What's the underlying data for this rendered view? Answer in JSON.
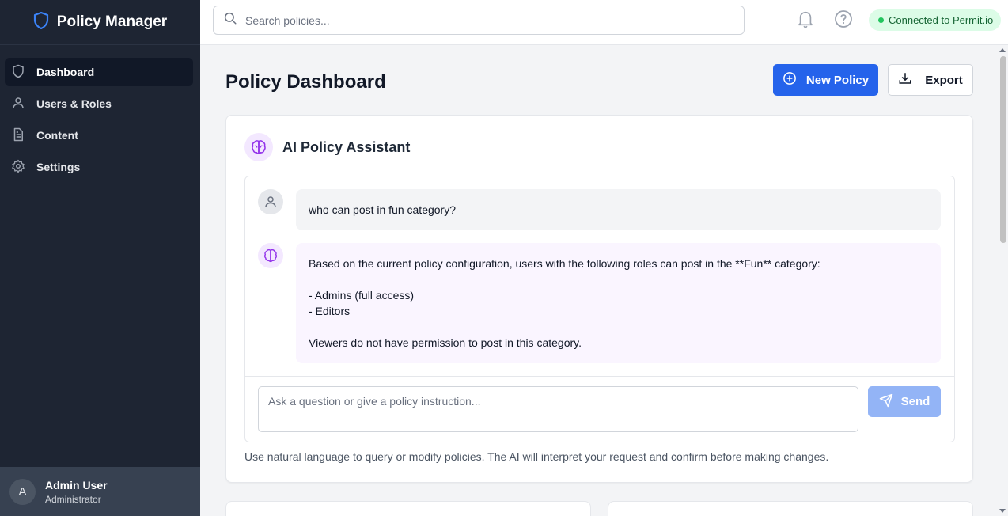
{
  "app": {
    "title": "Policy Manager"
  },
  "sidebar": {
    "items": [
      {
        "label": "Dashboard",
        "icon": "shield-icon",
        "active": true
      },
      {
        "label": "Users & Roles",
        "icon": "user-icon",
        "active": false
      },
      {
        "label": "Content",
        "icon": "document-icon",
        "active": false
      },
      {
        "label": "Settings",
        "icon": "gear-icon",
        "active": false
      }
    ],
    "user": {
      "initial": "A",
      "name": "Admin User",
      "role": "Administrator"
    }
  },
  "topbar": {
    "search_placeholder": "Search policies...",
    "status_text": "Connected to Permit.io",
    "icons": [
      "bell-icon",
      "help-icon"
    ]
  },
  "page": {
    "title": "Policy Dashboard",
    "new_policy_label": "New Policy",
    "export_label": "Export"
  },
  "assistant": {
    "title": "AI Policy Assistant",
    "messages": [
      {
        "role": "user",
        "text": "who can post in fun category?"
      },
      {
        "role": "ai",
        "text": "Based on the current policy configuration, users with the following roles can post in the **Fun** category:\n\n- Admins (full access)\n- Editors\n\nViewers do not have permission to post in this category."
      }
    ],
    "input_placeholder": "Ask a question or give a policy instruction...",
    "send_label": "Send",
    "hint": "Use natural language to query or modify policies. The AI will interpret your request and confirm before making changes."
  },
  "colors": {
    "sidebar_bg": "#1e2533",
    "accent": "#2563eb",
    "status_bg": "#dcfce7",
    "status_text": "#166534",
    "ai_accent": "#9333ea"
  }
}
